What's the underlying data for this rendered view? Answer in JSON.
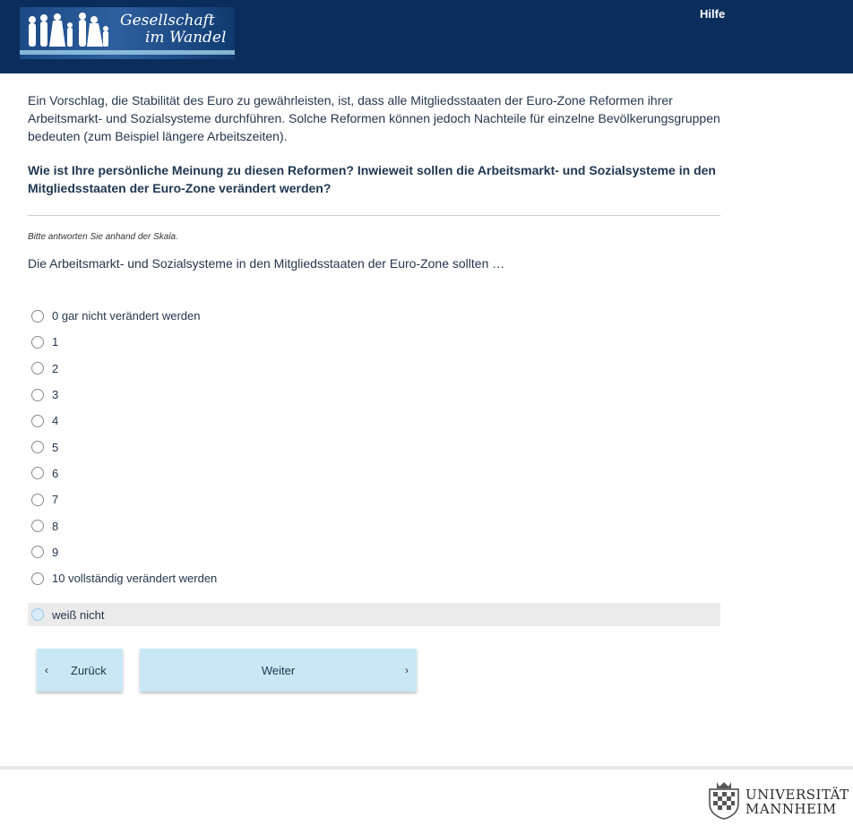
{
  "header": {
    "logo_line1": "Gesellschaft",
    "logo_line2": "im Wandel",
    "help_label": "Hilfe"
  },
  "survey": {
    "intro": "Ein Vorschlag, die Stabilität des Euro zu gewährleisten, ist, dass alle Mitgliedsstaaten der Euro-Zone Reformen ihrer Arbeitsmarkt- und Sozialsysteme durchführen. Solche Reformen können jedoch Nachteile für einzelne Bevölkerungsgruppen bedeuten (zum Beispiel längere Arbeitszeiten).",
    "question": "Wie ist Ihre persönliche Meinung zu diesen Reformen? Inwieweit sollen die Arbeitsmarkt- und Sozialsysteme in den Mitgliedsstaaten der Euro-Zone verändert werden?",
    "instruction": "Bitte antworten Sie anhand der Skala.",
    "stem": "Die Arbeitsmarkt- und Sozialsysteme in den Mitgliedsstaaten der Euro-Zone sollten …",
    "options": [
      "0 gar nicht verändert werden",
      "1",
      "2",
      "3",
      "4",
      "5",
      "6",
      "7",
      "8",
      "9",
      "10 vollständig verändert werden"
    ],
    "dont_know": "weiß nicht"
  },
  "navigation": {
    "back_label": "Zurück",
    "next_label": "Weiter"
  },
  "footer": {
    "university_line1": "UNIVERSITÄT",
    "university_line2": "MANNHEIM"
  },
  "colors": {
    "header_bg": "#0b2d5c",
    "button_bg": "#c8e8f6",
    "dont_know_bg": "#ebebeb"
  }
}
